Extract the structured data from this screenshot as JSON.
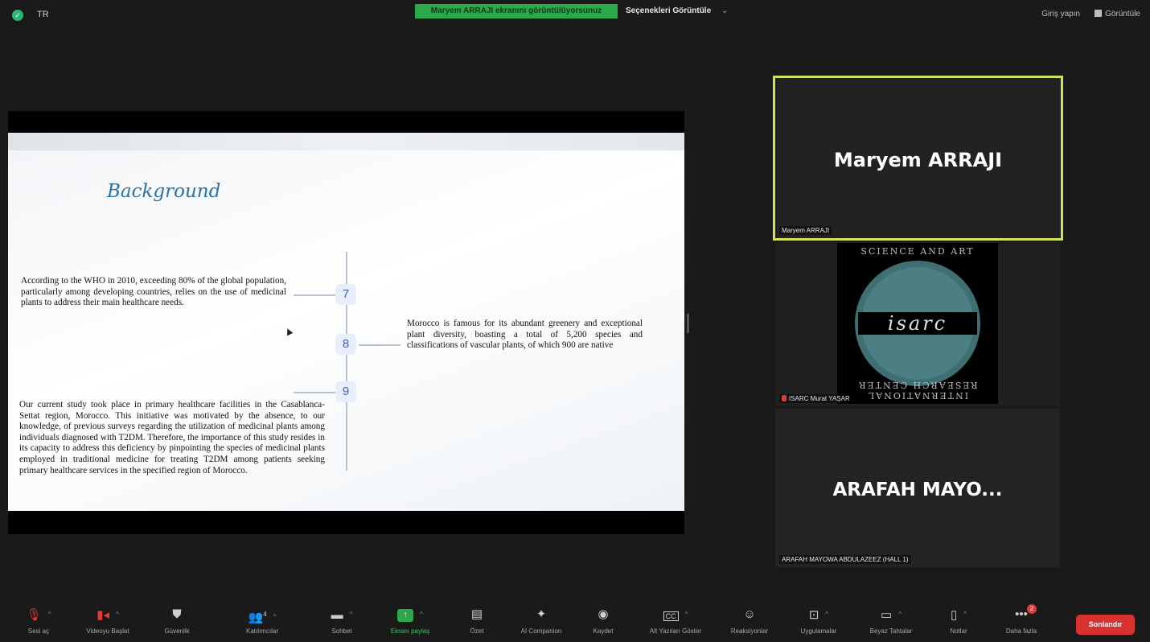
{
  "topbar": {
    "region": "TR",
    "share_banner": "Maryem ARRAJI ekranını görüntülüyorsunuz",
    "view_options": "Seçenekleri Görüntüle",
    "view_options_caret": "⌄",
    "login": "Giriş yapın",
    "view": "Görüntüle"
  },
  "slide": {
    "title": "Background",
    "point1": "According to the WHO in 2010, exceeding 80% of the global population, particularly among developing countries, relies on the use of medicinal plants to address their main healthcare needs.",
    "point2": "Morocco is famous for its abundant greenery and exceptional plant diversity, boasting a total of 5,200 species and classifications of vascular plants, of which 900 are native",
    "point3": "Our current study took place in primary healthcare facilities in the Casablanca- Settat region, Morocco. This initiative was motivated by the absence, to our knowledge, of previous surveys regarding the utilization of medicinal plants among individuals diagnosed with T2DM. Therefore, the importance of this study resides in its capacity to address this deficiency by pinpointing the species of medicinal plants employed in traditional medicine for treating T2DM among patients seeking primary healthcare services in the specified region of Morocco.",
    "nodes": [
      "7",
      "8",
      "9"
    ]
  },
  "participants": [
    {
      "display": "Maryem ARRAJI",
      "label": "Maryem ARRAJI"
    },
    {
      "label": "ISARC Murat YAŞAR",
      "logo_word": "isarc",
      "logo_top": "SCIENCE AND ART",
      "logo_bottom": "INTERNATIONAL RESEARCH CENTER"
    },
    {
      "display": "ARAFAH  MAYO...",
      "label": "ARAFAH MAYOWA ABDULAZEEZ (HALL 1)"
    }
  ],
  "toolbar": {
    "audio": "Sesi aç",
    "video": "Videoyu Başlat",
    "security": "Güvenlik",
    "participants": "Katılımcılar",
    "participants_count": "4",
    "chat": "Sohbet",
    "share": "Ekranı paylaş",
    "summary": "Özet",
    "ai": "AI Companion",
    "record": "Kaydet",
    "captions": "Alt Yazıları Göster",
    "reactions": "Reaksiyonlar",
    "apps": "Uygulamalar",
    "whiteboard": "Beyaz Tahtalar",
    "notes": "Notlar",
    "more": "Daha fazla",
    "more_badge": "2",
    "end": "Sonlandır"
  },
  "colors": {
    "accent_green": "#2aa84a",
    "speaker_border": "#d4e157",
    "end_red": "#d93030",
    "title_blue": "#2a71a8"
  }
}
